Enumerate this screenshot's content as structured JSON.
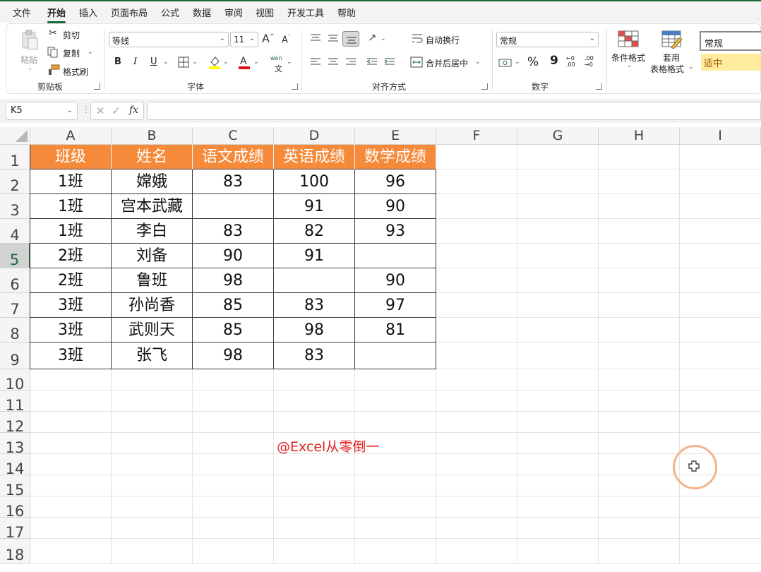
{
  "menu": {
    "tabs": [
      "文件",
      "开始",
      "插入",
      "页面布局",
      "公式",
      "数据",
      "审阅",
      "视图",
      "开发工具",
      "帮助"
    ],
    "active": "开始"
  },
  "ribbon": {
    "clipboard": {
      "paste": "粘贴",
      "cut": "剪切",
      "copy": "复制",
      "format_painter": "格式刷",
      "label": "剪贴板"
    },
    "font": {
      "name": "等线",
      "size": "11",
      "bold": "B",
      "italic": "I",
      "underline": "U",
      "wen_top": "wén",
      "wen_bottom": "文",
      "label": "字体"
    },
    "alignment": {
      "wrap_text": "自动换行",
      "merge_center": "合并后居中",
      "label": "对齐方式"
    },
    "number": {
      "format": "常规",
      "percent": "%",
      "comma": "9",
      "increase_decimal": "←0 .00",
      "decrease_decimal": ".00 →0",
      "label": "数字"
    },
    "styles": {
      "conditional_format": "条件格式",
      "table_format_1": "套用",
      "table_format_2": "表格格式",
      "normal": "常规",
      "neutral": "适中"
    }
  },
  "formula_bar": {
    "name_box": "K5",
    "fx": "fx",
    "value": ""
  },
  "grid": {
    "columns": [
      "A",
      "B",
      "C",
      "D",
      "E",
      "F",
      "G",
      "H",
      "I"
    ],
    "rows": [
      "1",
      "2",
      "3",
      "4",
      "5",
      "6",
      "7",
      "8",
      "9",
      "10",
      "11",
      "12",
      "13",
      "14",
      "15",
      "16",
      "17",
      "18"
    ],
    "selected_row": "5",
    "header_color": "#f58a3a"
  },
  "table": {
    "headers": [
      "班级",
      "姓名",
      "语文成绩",
      "英语成绩",
      "数学成绩"
    ],
    "rows": [
      [
        "1班",
        "嫦娥",
        "83",
        "100",
        "96"
      ],
      [
        "1班",
        "宫本武藏",
        "",
        "91",
        "90"
      ],
      [
        "1班",
        "李白",
        "83",
        "82",
        "93"
      ],
      [
        "2班",
        "刘备",
        "90",
        "91",
        ""
      ],
      [
        "2班",
        "鲁班",
        "98",
        "",
        "90"
      ],
      [
        "3班",
        "孙尚香",
        "85",
        "83",
        "97"
      ],
      [
        "3班",
        "武则天",
        "85",
        "98",
        "81"
      ],
      [
        "3班",
        "张飞",
        "98",
        "83",
        ""
      ]
    ]
  },
  "watermark": "@Excel从零倒一"
}
